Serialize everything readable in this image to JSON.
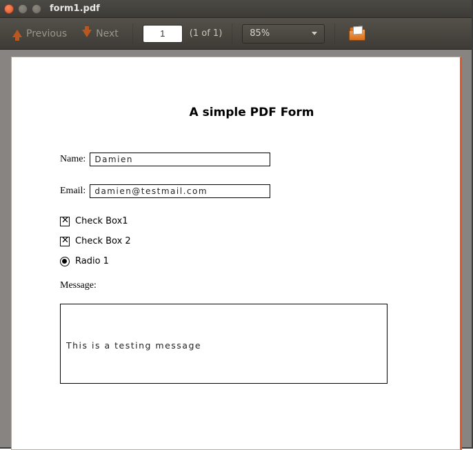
{
  "window": {
    "title": "form1.pdf"
  },
  "toolbar": {
    "prev_label": "Previous",
    "next_label": "Next",
    "page_value": "1",
    "page_of_text": "(1 of 1)",
    "zoom_value": "85%"
  },
  "document": {
    "title": "A simple PDF Form",
    "name_label": "Name:",
    "name_value": "Damien",
    "email_label": "Email:",
    "email_value": "damien@testmail.com",
    "checkbox1": {
      "label": "Check Box1",
      "checked": true
    },
    "checkbox2": {
      "label": "Check Box 2",
      "checked": true
    },
    "radio1": {
      "label": "Radio 1",
      "checked": true
    },
    "message_label": "Message:",
    "message_value": "This is a testing message"
  }
}
